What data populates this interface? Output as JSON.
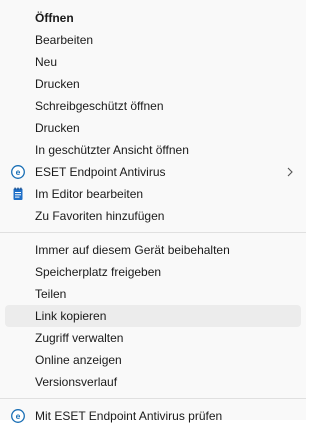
{
  "menu": {
    "group1": [
      {
        "label": "Öffnen",
        "bold": true
      },
      {
        "label": "Bearbeiten"
      },
      {
        "label": "Neu"
      },
      {
        "label": "Drucken"
      },
      {
        "label": "Schreibgeschützt öffnen"
      },
      {
        "label": "Drucken"
      },
      {
        "label": "In geschützter Ansicht öffnen"
      },
      {
        "label": "ESET Endpoint Antivirus",
        "icon": "eset-icon",
        "submenu": true
      },
      {
        "label": "Im Editor bearbeiten",
        "icon": "notepad-icon"
      },
      {
        "label": "Zu Favoriten hinzufügen"
      }
    ],
    "group2": [
      {
        "label": "Immer auf diesem Gerät beibehalten"
      },
      {
        "label": "Speicherplatz freigeben"
      },
      {
        "label": "Teilen"
      },
      {
        "label": "Link kopieren",
        "highlighted": true
      },
      {
        "label": "Zugriff verwalten"
      },
      {
        "label": "Online anzeigen"
      },
      {
        "label": "Versionsverlauf"
      }
    ],
    "group3": [
      {
        "label": "Mit ESET Endpoint Antivirus prüfen",
        "icon": "eset-icon"
      }
    ]
  },
  "colors": {
    "menu_bg": "#f9f9f9",
    "highlight_bg": "#ececec",
    "eset_blue": "#1a6fb5",
    "notepad_blue": "#1f6fc7"
  }
}
